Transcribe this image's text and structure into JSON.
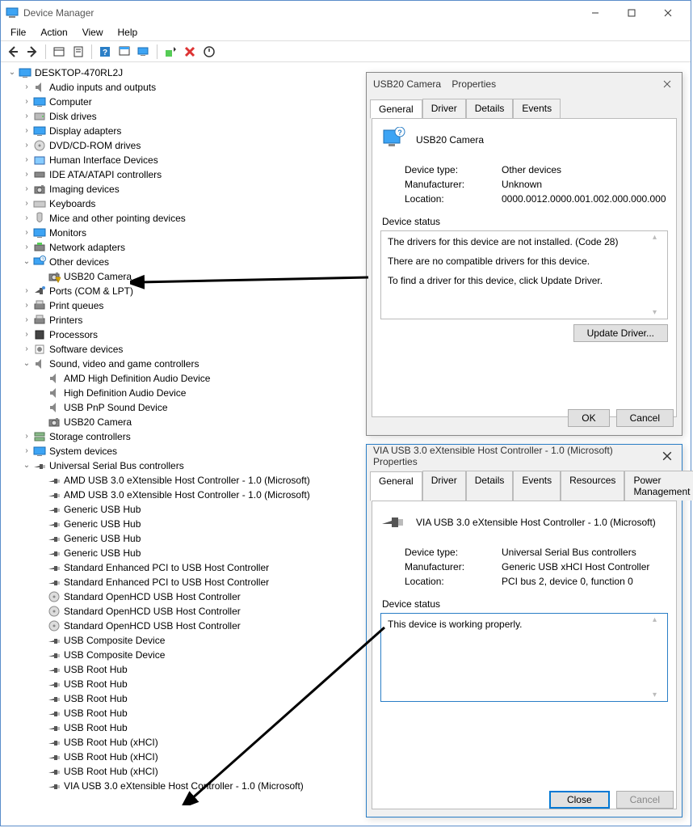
{
  "window": {
    "title": "Device Manager"
  },
  "menu": {
    "file": "File",
    "action": "Action",
    "view": "View",
    "help": "Help"
  },
  "root": "DESKTOP-470RL2J",
  "categories": [
    {
      "label": "Audio inputs and outputs",
      "collapsed": true
    },
    {
      "label": "Computer",
      "collapsed": true
    },
    {
      "label": "Disk drives",
      "collapsed": true
    },
    {
      "label": "Display adapters",
      "collapsed": true
    },
    {
      "label": "DVD/CD-ROM drives",
      "collapsed": true
    },
    {
      "label": "Human Interface Devices",
      "collapsed": true
    },
    {
      "label": "IDE ATA/ATAPI controllers",
      "collapsed": true
    },
    {
      "label": "Imaging devices",
      "collapsed": true
    },
    {
      "label": "Keyboards",
      "collapsed": true
    },
    {
      "label": "Mice and other pointing devices",
      "collapsed": true
    },
    {
      "label": "Monitors",
      "collapsed": true
    },
    {
      "label": "Network adapters",
      "collapsed": true
    },
    {
      "label": "Other devices",
      "collapsed": false,
      "children": [
        {
          "label": "USB20 Camera",
          "warning": true
        }
      ]
    },
    {
      "label": "Ports (COM & LPT)",
      "collapsed": true
    },
    {
      "label": "Print queues",
      "collapsed": true
    },
    {
      "label": "Printers",
      "collapsed": true
    },
    {
      "label": "Processors",
      "collapsed": true
    },
    {
      "label": "Software devices",
      "collapsed": true
    },
    {
      "label": "Sound, video and game controllers",
      "collapsed": false,
      "children": [
        {
          "label": "AMD High Definition Audio Device"
        },
        {
          "label": "High Definition Audio Device"
        },
        {
          "label": "USB PnP Sound Device"
        },
        {
          "label": "USB20 Camera"
        }
      ]
    },
    {
      "label": "Storage controllers",
      "collapsed": true
    },
    {
      "label": "System devices",
      "collapsed": true
    },
    {
      "label": "Universal Serial Bus controllers",
      "collapsed": false,
      "children": [
        {
          "label": "AMD USB 3.0 eXtensible Host Controller - 1.0 (Microsoft)"
        },
        {
          "label": "AMD USB 3.0 eXtensible Host Controller - 1.0 (Microsoft)"
        },
        {
          "label": "Generic USB Hub"
        },
        {
          "label": "Generic USB Hub"
        },
        {
          "label": "Generic USB Hub"
        },
        {
          "label": "Generic USB Hub"
        },
        {
          "label": "Standard Enhanced PCI to USB Host Controller"
        },
        {
          "label": "Standard Enhanced PCI to USB Host Controller"
        },
        {
          "label": "Standard OpenHCD USB Host Controller"
        },
        {
          "label": "Standard OpenHCD USB Host Controller"
        },
        {
          "label": "Standard OpenHCD USB Host Controller"
        },
        {
          "label": "USB Composite Device"
        },
        {
          "label": "USB Composite Device"
        },
        {
          "label": "USB Root Hub"
        },
        {
          "label": "USB Root Hub"
        },
        {
          "label": "USB Root Hub"
        },
        {
          "label": "USB Root Hub"
        },
        {
          "label": "USB Root Hub"
        },
        {
          "label": "USB Root Hub (xHCI)"
        },
        {
          "label": "USB Root Hub (xHCI)"
        },
        {
          "label": "USB Root Hub (xHCI)"
        },
        {
          "label": "VIA USB 3.0 eXtensible Host Controller - 1.0 (Microsoft)"
        }
      ]
    }
  ],
  "dlg1": {
    "title_prefix": "USB20 Camera",
    "title_suffix": "Properties",
    "tabs": [
      "General",
      "Driver",
      "Details",
      "Events"
    ],
    "name": "USB20 Camera",
    "device_type_k": "Device type:",
    "device_type_v": "Other devices",
    "manufacturer_k": "Manufacturer:",
    "manufacturer_v": "Unknown",
    "location_k": "Location:",
    "location_v": "0000.0012.0000.001.002.000.000.000",
    "status_label": "Device status",
    "status_lines": [
      "The drivers for this device are not installed. (Code 28)",
      "There are no compatible drivers for this device.",
      "To find a driver for this device, click Update Driver."
    ],
    "update_btn": "Update Driver...",
    "ok": "OK",
    "cancel": "Cancel"
  },
  "dlg2": {
    "title": "VIA USB 3.0 eXtensible Host Controller - 1.0 (Microsoft) Properties",
    "tabs": [
      "General",
      "Driver",
      "Details",
      "Events",
      "Resources",
      "Power Management"
    ],
    "name": "VIA USB 3.0 eXtensible Host Controller - 1.0 (Microsoft)",
    "device_type_k": "Device type:",
    "device_type_v": "Universal Serial Bus controllers",
    "manufacturer_k": "Manufacturer:",
    "manufacturer_v": "Generic USB xHCI Host Controller",
    "location_k": "Location:",
    "location_v": "PCI bus 2, device 0, function 0",
    "status_label": "Device status",
    "status": "This device is working properly.",
    "close": "Close",
    "cancel": "Cancel"
  }
}
